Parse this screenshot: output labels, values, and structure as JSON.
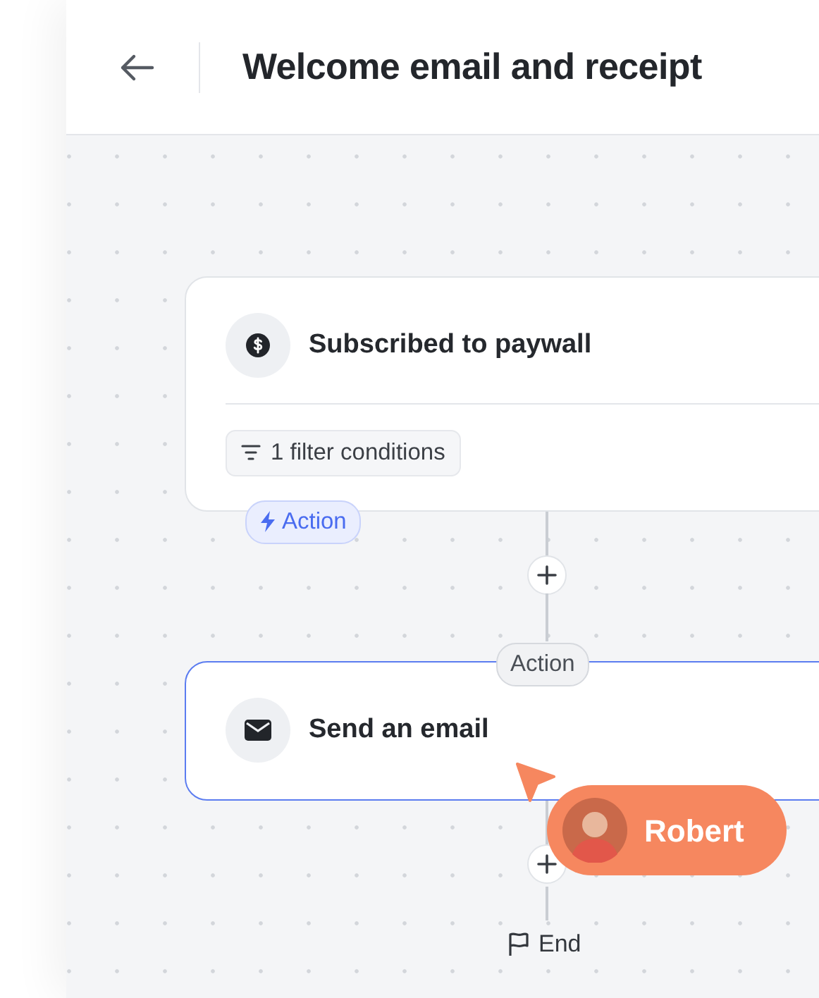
{
  "header": {
    "title": "Welcome email and receipt"
  },
  "nodes": [
    {
      "kind": "trigger",
      "title": "Subscribed to paywall",
      "filter": "1 filter conditions",
      "tag": "Action",
      "selected": false
    },
    {
      "kind": "action",
      "title": "Send an email",
      "tag": "Action",
      "selected": true
    }
  ],
  "end_label": "End",
  "cursor": {
    "user": "Robert"
  }
}
